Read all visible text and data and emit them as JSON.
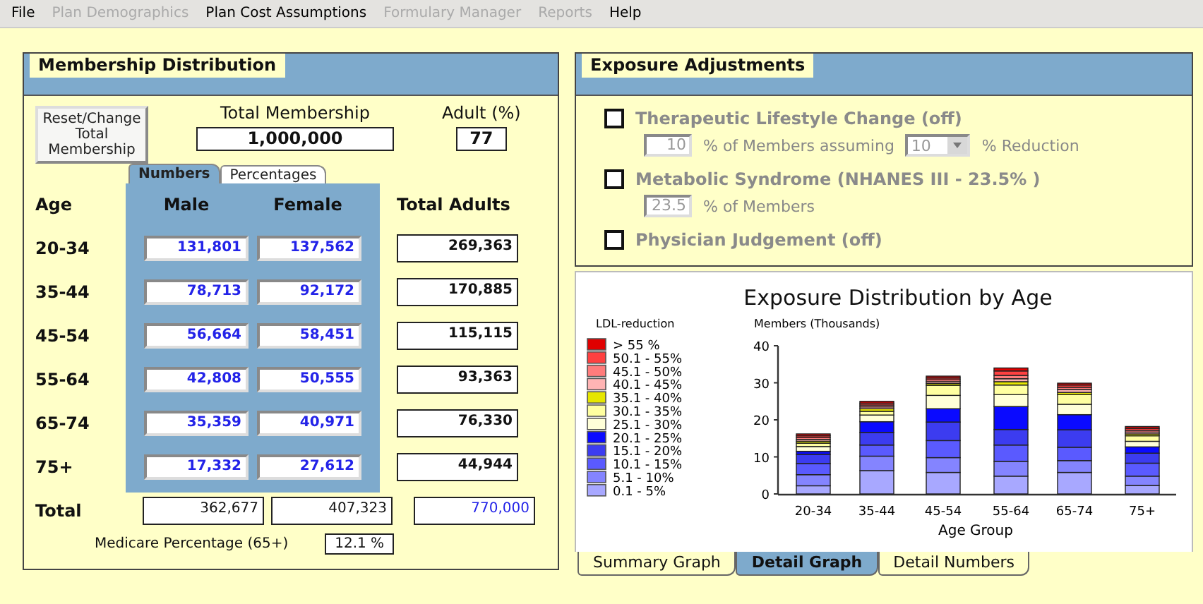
{
  "menu": [
    {
      "label": "File",
      "disabled": false
    },
    {
      "label": "Plan Demographics",
      "disabled": true
    },
    {
      "label": "Plan Cost Assumptions",
      "disabled": false
    },
    {
      "label": "Formulary Manager",
      "disabled": true
    },
    {
      "label": "Reports",
      "disabled": true
    },
    {
      "label": "Help",
      "disabled": false
    }
  ],
  "membership": {
    "title": "Membership Distribution",
    "reset_button": "Reset/Change Total Membership",
    "total_label": "Total Membership",
    "total_value": "1,000,000",
    "adult_label": "Adult (%)",
    "adult_value": "77",
    "tabs": [
      {
        "label": "Numbers",
        "selected": true
      },
      {
        "label": "Percentages",
        "selected": false
      }
    ],
    "columns": {
      "age": "Age",
      "male": "Male",
      "female": "Female",
      "total": "Total Adults"
    },
    "rows": [
      {
        "age": "20-34",
        "male": "131,801",
        "female": "137,562",
        "total": "269,363"
      },
      {
        "age": "35-44",
        "male": "78,713",
        "female": "92,172",
        "total": "170,885"
      },
      {
        "age": "45-54",
        "male": "56,664",
        "female": "58,451",
        "total": "115,115"
      },
      {
        "age": "55-64",
        "male": "42,808",
        "female": "50,555",
        "total": "93,363"
      },
      {
        "age": "65-74",
        "male": "35,359",
        "female": "40,971",
        "total": "76,330"
      },
      {
        "age": "75+",
        "male": "17,332",
        "female": "27,612",
        "total": "44,944"
      }
    ],
    "totals": {
      "label": "Total",
      "male": "362,677",
      "female": "407,323",
      "total": "770,000"
    },
    "medicare_label": "Medicare Percentage (65+)",
    "medicare_value": "12.1 %"
  },
  "exposure": {
    "title": "Exposure Adjustments",
    "options": [
      {
        "label": "Therapeutic Lifestyle Change (off)",
        "checked": false,
        "disabled": true,
        "inputs": [
          {
            "kind": "field",
            "value": "10"
          },
          {
            "kind": "text",
            "text": "% of Members assuming"
          },
          {
            "kind": "select",
            "value": "10"
          },
          {
            "kind": "text",
            "text": "% Reduction"
          }
        ]
      },
      {
        "label": "Metabolic Syndrome (NHANES III - 23.5% )",
        "checked": false,
        "disabled": true,
        "inputs": [
          {
            "kind": "field",
            "value": "23.5"
          },
          {
            "kind": "text",
            "text": "% of Members"
          }
        ]
      },
      {
        "label": "Physician Judgement (off)",
        "checked": false,
        "disabled": true
      }
    ]
  },
  "graph": {
    "title": "Exposure Distribution by Age",
    "legend_title": "LDL-reduction",
    "chart_data": {
      "type": "bar",
      "stacked": true,
      "legend": true,
      "ylabel": "Members (Thousands)",
      "xlabel": "Age Group",
      "categories": [
        "20-34",
        "35-44",
        "45-54",
        "55-64",
        "65-74",
        "75+"
      ],
      "yticks": [
        0,
        10,
        20,
        30,
        40
      ],
      "ylim": [
        0,
        40
      ],
      "series": [
        {
          "name": "0.1 - 5%",
          "color": "#a8a8ff",
          "values": [
            2.2,
            6.3,
            5.8,
            4.8,
            5.8,
            2.3
          ]
        },
        {
          "name": "5.1 - 10%",
          "color": "#8484ff",
          "values": [
            3,
            3.9,
            4,
            4,
            3.2,
            2.5
          ]
        },
        {
          "name": "10.1 - 15%",
          "color": "#5a5aff",
          "values": [
            3,
            3,
            4.6,
            4.4,
            3.6,
            3.5
          ]
        },
        {
          "name": "15.1 - 20%",
          "color": "#3c3cf0",
          "values": [
            2.5,
            3.4,
            5,
            4.2,
            4.7,
            2.7
          ]
        },
        {
          "name": "20.1 - 25%",
          "color": "#0a0aff",
          "values": [
            0.8,
            2.9,
            3.6,
            6.2,
            4.1,
            1.7
          ]
        },
        {
          "name": "25.1 - 30%",
          "color": "#ffffd8",
          "values": [
            1.3,
            1.8,
            3.6,
            3.2,
            2.8,
            1.5
          ]
        },
        {
          "name": "30.1 - 35%",
          "color": "#ffffa0",
          "values": [
            0.9,
            1,
            2.7,
            2.6,
            2.6,
            1.5
          ]
        },
        {
          "name": "35.1 - 40%",
          "color": "#e6e600",
          "values": [
            0.5,
            0.7,
            0.5,
            0.9,
            0.6,
            0.5
          ]
        },
        {
          "name": "40.1 - 45%",
          "color": "#ffb4b4",
          "values": [
            0.5,
            0.5,
            0.5,
            0.8,
            0.8,
            0.5
          ]
        },
        {
          "name": "45.1 - 50%",
          "color": "#ff7c7c",
          "values": [
            0.5,
            0.5,
            0.5,
            0.9,
            0.6,
            0.5
          ]
        },
        {
          "name": "50.1 - 55%",
          "color": "#ff4040",
          "values": [
            0.5,
            0.5,
            0.5,
            1.2,
            0.6,
            0.5
          ]
        },
        {
          "name": "> 55 %",
          "color": "#e00000",
          "values": [
            0.5,
            0.5,
            0.5,
            0.8,
            0.5,
            0.5
          ]
        }
      ]
    }
  },
  "graph_tabs": [
    {
      "label": "Summary Graph",
      "selected": false
    },
    {
      "label": "Detail Graph",
      "selected": true
    },
    {
      "label": "Detail Numbers",
      "selected": false
    }
  ]
}
